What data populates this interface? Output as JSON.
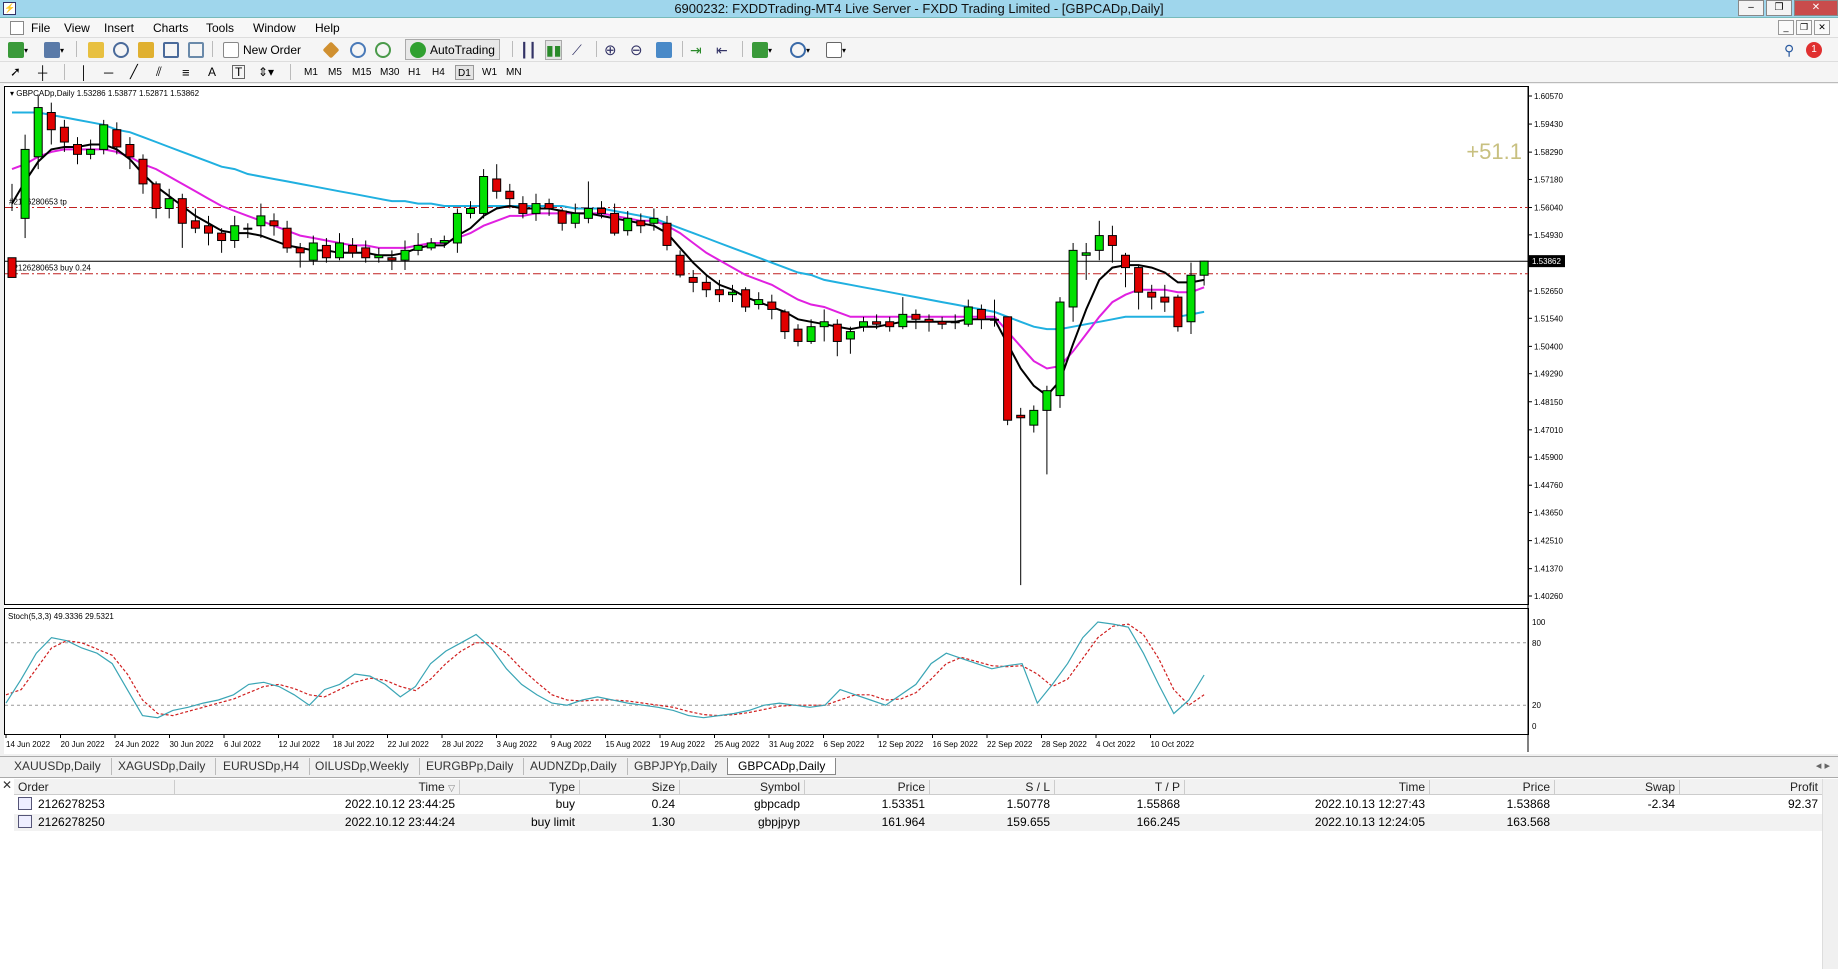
{
  "window": {
    "title": "6900232: FXDDTrading-MT4 Live Server - FXDD Trading Limited - [GBPCADp,Daily]",
    "minimize": "–",
    "restore": "❐",
    "close": "✕"
  },
  "menu": [
    "File",
    "View",
    "Insert",
    "Charts",
    "Tools",
    "Window",
    "Help"
  ],
  "toolbar": {
    "new_order": "New Order",
    "auto_trading": "AutoTrading",
    "timeframes": [
      "M1",
      "M5",
      "M15",
      "M30",
      "H1",
      "H4",
      "D1",
      "W1",
      "MN"
    ],
    "active_timeframe": "D1",
    "notification_count": "1"
  },
  "chart": {
    "header": "GBPCADp,Daily  1.53286 1.53877 1.52871 1.53862",
    "profit_overlay": "+51.1",
    "tp_label": "#2126280653 tp",
    "buy_label": "#2126280653 buy 0.24",
    "price_tag": "1.53862",
    "price_axis": [
      "1.60570",
      "1.59430",
      "1.58290",
      "1.57180",
      "1.56040",
      "1.54930",
      "1.53862",
      "1.52650",
      "1.51540",
      "1.50400",
      "1.49290",
      "1.48150",
      "1.47010",
      "1.45900",
      "1.44760",
      "1.43650",
      "1.42510",
      "1.41370",
      "1.40260"
    ],
    "indicator_header": "Stoch(5,3,3) 49.3336 29.5321",
    "indicator_axis": [
      "100",
      "80",
      "20",
      "0"
    ],
    "date_labels": [
      "14 Jun 2022",
      "20 Jun 2022",
      "24 Jun 2022",
      "30 Jun 2022",
      "6 Jul 2022",
      "12 Jul 2022",
      "18 Jul 2022",
      "22 Jul 2022",
      "28 Jul 2022",
      "3 Aug 2022",
      "9 Aug 2022",
      "15 Aug 2022",
      "19 Aug 2022",
      "25 Aug 2022",
      "31 Aug 2022",
      "6 Sep 2022",
      "12 Sep 2022",
      "16 Sep 2022",
      "22 Sep 2022",
      "28 Sep 2022",
      "4 Oct 2022",
      "10 Oct 2022"
    ],
    "colors": {
      "bull": "#00e000",
      "bear": "#e00000",
      "ma_fast": "#000000",
      "ma_mid": "#e020e0",
      "ma_slow": "#20b0e0",
      "stoch_main": "#3aa5b5",
      "stoch_signal": "#d02020",
      "profit": "#c8c080"
    }
  },
  "chart_data": {
    "type": "candlestick",
    "title": "GBPCADp,Daily",
    "candles": [
      [
        1.54,
        1.532,
        1.559,
        1.57
      ],
      [
        1.556,
        1.584,
        1.59,
        1.548
      ],
      [
        1.581,
        1.601,
        1.606,
        1.576
      ],
      [
        1.599,
        1.592,
        1.603,
        1.586
      ],
      [
        1.593,
        1.587,
        1.596,
        1.583
      ],
      [
        1.586,
        1.582,
        1.589,
        1.578
      ],
      [
        1.582,
        1.584,
        1.588,
        1.58
      ],
      [
        1.584,
        1.594,
        1.596,
        1.582
      ],
      [
        1.592,
        1.585,
        1.595,
        1.582
      ],
      [
        1.586,
        1.581,
        1.589,
        1.576
      ],
      [
        1.58,
        1.57,
        1.582,
        1.566
      ],
      [
        1.57,
        1.56,
        1.571,
        1.556
      ],
      [
        1.56,
        1.564,
        1.568,
        1.556
      ],
      [
        1.564,
        1.554,
        1.566,
        1.544
      ],
      [
        1.555,
        1.552,
        1.56,
        1.55
      ],
      [
        1.553,
        1.55,
        1.557,
        1.545
      ],
      [
        1.55,
        1.547,
        1.552,
        1.542
      ],
      [
        1.547,
        1.553,
        1.557,
        1.544
      ],
      [
        1.552,
        1.552,
        1.554,
        1.548
      ],
      [
        1.553,
        1.557,
        1.562,
        1.548
      ],
      [
        1.555,
        1.553,
        1.558,
        1.549
      ],
      [
        1.552,
        1.544,
        1.555,
        1.542
      ],
      [
        1.544,
        1.542,
        1.546,
        1.536
      ],
      [
        1.539,
        1.546,
        1.549,
        1.537
      ],
      [
        1.545,
        1.54,
        1.548,
        1.538
      ],
      [
        1.54,
        1.546,
        1.55,
        1.539
      ],
      [
        1.545,
        1.542,
        1.548,
        1.54
      ],
      [
        1.544,
        1.54,
        1.547,
        1.538
      ],
      [
        1.54,
        1.541,
        1.544,
        1.538
      ],
      [
        1.54,
        1.539,
        1.543,
        1.535
      ],
      [
        1.539,
        1.543,
        1.547,
        1.535
      ],
      [
        1.543,
        1.545,
        1.55,
        1.541
      ],
      [
        1.544,
        1.546,
        1.548,
        1.543
      ],
      [
        1.546,
        1.547,
        1.549,
        1.544
      ],
      [
        1.546,
        1.558,
        1.56,
        1.542
      ],
      [
        1.558,
        1.56,
        1.563,
        1.556
      ],
      [
        1.558,
        1.573,
        1.576,
        1.556
      ],
      [
        1.572,
        1.567,
        1.578,
        1.564
      ],
      [
        1.567,
        1.564,
        1.57,
        1.56
      ],
      [
        1.562,
        1.558,
        1.565,
        1.556
      ],
      [
        1.558,
        1.562,
        1.566,
        1.555
      ],
      [
        1.562,
        1.56,
        1.564,
        1.557
      ],
      [
        1.559,
        1.554,
        1.56,
        1.551
      ],
      [
        1.554,
        1.558,
        1.562,
        1.552
      ],
      [
        1.556,
        1.56,
        1.571,
        1.554
      ],
      [
        1.56,
        1.558,
        1.563,
        1.556
      ],
      [
        1.558,
        1.55,
        1.562,
        1.549
      ],
      [
        1.551,
        1.556,
        1.559,
        1.549
      ],
      [
        1.555,
        1.553,
        1.558,
        1.55
      ],
      [
        1.554,
        1.556,
        1.56,
        1.551
      ],
      [
        1.554,
        1.545,
        1.557,
        1.543
      ],
      [
        1.541,
        1.533,
        1.543,
        1.532
      ],
      [
        1.532,
        1.53,
        1.535,
        1.526
      ],
      [
        1.53,
        1.527,
        1.533,
        1.524
      ],
      [
        1.527,
        1.525,
        1.531,
        1.522
      ],
      [
        1.525,
        1.526,
        1.529,
        1.522
      ],
      [
        1.527,
        1.52,
        1.528,
        1.518
      ],
      [
        1.521,
        1.523,
        1.526,
        1.519
      ],
      [
        1.522,
        1.519,
        1.525,
        1.515
      ],
      [
        1.518,
        1.51,
        1.519,
        1.507
      ],
      [
        1.511,
        1.506,
        1.513,
        1.504
      ],
      [
        1.506,
        1.512,
        1.515,
        1.505
      ],
      [
        1.512,
        1.514,
        1.519,
        1.506
      ],
      [
        1.513,
        1.506,
        1.515,
        1.5
      ],
      [
        1.507,
        1.51,
        1.512,
        1.501
      ],
      [
        1.512,
        1.514,
        1.516,
        1.51
      ],
      [
        1.514,
        1.513,
        1.517,
        1.511
      ],
      [
        1.514,
        1.512,
        1.516,
        1.51
      ],
      [
        1.512,
        1.517,
        1.524,
        1.511
      ],
      [
        1.517,
        1.515,
        1.519,
        1.511
      ],
      [
        1.515,
        1.514,
        1.517,
        1.51
      ],
      [
        1.514,
        1.513,
        1.516,
        1.511
      ],
      [
        1.514,
        1.514,
        1.517,
        1.511
      ],
      [
        1.513,
        1.52,
        1.523,
        1.512
      ],
      [
        1.519,
        1.515,
        1.521,
        1.511
      ],
      [
        1.515,
        1.515,
        1.523,
        1.512
      ],
      [
        1.516,
        1.474,
        1.516,
        1.472
      ],
      [
        1.476,
        1.475,
        1.479,
        1.407
      ],
      [
        1.472,
        1.478,
        1.48,
        1.469
      ],
      [
        1.478,
        1.486,
        1.488,
        1.452
      ],
      [
        1.484,
        1.522,
        1.524,
        1.479
      ],
      [
        1.52,
        1.543,
        1.546,
        1.514
      ],
      [
        1.541,
        1.542,
        1.546,
        1.531
      ],
      [
        1.543,
        1.549,
        1.555,
        1.539
      ],
      [
        1.549,
        1.545,
        1.553,
        1.538
      ],
      [
        1.541,
        1.536,
        1.542,
        1.528
      ],
      [
        1.536,
        1.526,
        1.537,
        1.519
      ],
      [
        1.526,
        1.524,
        1.529,
        1.519
      ],
      [
        1.524,
        1.522,
        1.529,
        1.518
      ],
      [
        1.524,
        1.512,
        1.525,
        1.51
      ],
      [
        1.514,
        1.5329,
        1.538,
        1.509
      ],
      [
        1.5329,
        1.5386,
        1.5388,
        1.5287
      ]
    ],
    "ma_fast": [
      1.562,
      1.571,
      1.579,
      1.584,
      1.585,
      1.585,
      1.586,
      1.586,
      1.584,
      1.58,
      1.574,
      1.569,
      1.565,
      1.561,
      1.557,
      1.554,
      1.551,
      1.55,
      1.55,
      1.549,
      1.547,
      1.545,
      1.544,
      1.543,
      1.543,
      1.542,
      1.542,
      1.542,
      1.541,
      1.541,
      1.542,
      1.544,
      1.545,
      1.545,
      1.549,
      1.552,
      1.557,
      1.56,
      1.561,
      1.56,
      1.56,
      1.56,
      1.559,
      1.558,
      1.558,
      1.557,
      1.556,
      1.555,
      1.554,
      1.553,
      1.55,
      1.544,
      1.538,
      1.533,
      1.529,
      1.527,
      1.524,
      1.522,
      1.52,
      1.518,
      1.515,
      1.514,
      1.513,
      1.512,
      1.511,
      1.512,
      1.512,
      1.513,
      1.514,
      1.514,
      1.514,
      1.514,
      1.514,
      1.515,
      1.515,
      1.515,
      1.505,
      1.495,
      1.488,
      1.484,
      1.49,
      1.505,
      1.519,
      1.531,
      1.536,
      1.537,
      1.537,
      1.536,
      1.534,
      1.53,
      1.53,
      1.531
    ],
    "ma_mid": [
      1.576,
      1.578,
      1.581,
      1.583,
      1.584,
      1.584,
      1.584,
      1.584,
      1.583,
      1.581,
      1.578,
      1.576,
      1.573,
      1.57,
      1.567,
      1.564,
      1.561,
      1.559,
      1.557,
      1.555,
      1.553,
      1.551,
      1.549,
      1.548,
      1.547,
      1.546,
      1.545,
      1.545,
      1.544,
      1.544,
      1.544,
      1.545,
      1.546,
      1.546,
      1.548,
      1.55,
      1.553,
      1.555,
      1.557,
      1.557,
      1.558,
      1.558,
      1.558,
      1.558,
      1.558,
      1.558,
      1.557,
      1.556,
      1.555,
      1.555,
      1.553,
      1.55,
      1.546,
      1.542,
      1.539,
      1.536,
      1.533,
      1.531,
      1.529,
      1.526,
      1.523,
      1.521,
      1.52,
      1.518,
      1.516,
      1.516,
      1.516,
      1.516,
      1.516,
      1.516,
      1.516,
      1.516,
      1.516,
      1.516,
      1.516,
      1.516,
      1.51,
      1.504,
      1.498,
      1.495,
      1.496,
      1.502,
      1.509,
      1.516,
      1.522,
      1.525,
      1.527,
      1.527,
      1.527,
      1.526,
      1.526,
      1.528
    ],
    "ma_slow": [
      1.599,
      1.599,
      1.599,
      1.598,
      1.597,
      1.596,
      1.595,
      1.594,
      1.592,
      1.591,
      1.589,
      1.587,
      1.585,
      1.583,
      1.581,
      1.579,
      1.577,
      1.576,
      1.574,
      1.573,
      1.572,
      1.571,
      1.57,
      1.569,
      1.568,
      1.567,
      1.566,
      1.565,
      1.564,
      1.563,
      1.563,
      1.562,
      1.562,
      1.561,
      1.561,
      1.561,
      1.561,
      1.561,
      1.561,
      1.561,
      1.561,
      1.561,
      1.561,
      1.56,
      1.56,
      1.56,
      1.559,
      1.558,
      1.557,
      1.556,
      1.554,
      1.552,
      1.55,
      1.548,
      1.546,
      1.544,
      1.542,
      1.54,
      1.538,
      1.536,
      1.534,
      1.533,
      1.531,
      1.53,
      1.529,
      1.528,
      1.527,
      1.526,
      1.525,
      1.524,
      1.523,
      1.522,
      1.521,
      1.52,
      1.519,
      1.518,
      1.516,
      1.514,
      1.512,
      1.511,
      1.511,
      1.512,
      1.513,
      1.514,
      1.515,
      1.516,
      1.516,
      1.516,
      1.516,
      1.516,
      1.517,
      1.518
    ],
    "stoch_main": [
      22,
      45,
      70,
      85,
      82,
      75,
      70,
      60,
      35,
      10,
      8,
      15,
      18,
      22,
      25,
      30,
      40,
      42,
      38,
      30,
      20,
      35,
      40,
      50,
      48,
      40,
      28,
      38,
      60,
      72,
      80,
      88,
      75,
      55,
      40,
      30,
      22,
      20,
      25,
      28,
      25,
      22,
      20,
      18,
      15,
      10,
      8,
      10,
      12,
      15,
      20,
      22,
      20,
      18,
      20,
      35,
      30,
      25,
      20,
      30,
      40,
      60,
      70,
      65,
      60,
      55,
      58,
      60,
      22,
      40,
      60,
      85,
      100,
      98,
      95,
      70,
      40,
      12,
      25,
      49
    ],
    "stoch_signal": [
      30,
      35,
      55,
      75,
      82,
      80,
      74,
      68,
      50,
      25,
      12,
      10,
      14,
      18,
      22,
      26,
      32,
      38,
      40,
      36,
      30,
      28,
      35,
      42,
      46,
      44,
      38,
      34,
      45,
      60,
      72,
      80,
      80,
      70,
      55,
      42,
      30,
      25,
      24,
      25,
      25,
      24,
      22,
      20,
      18,
      14,
      11,
      10,
      11,
      13,
      16,
      19,
      20,
      20,
      20,
      25,
      30,
      30,
      25,
      26,
      32,
      45,
      60,
      66,
      62,
      58,
      57,
      58,
      50,
      38,
      45,
      65,
      85,
      96,
      98,
      88,
      65,
      35,
      20,
      30
    ],
    "positions": {
      "tp": 1.5604,
      "entry": 1.53351,
      "stop": 1.50778
    },
    "ylim": [
      1.4026,
      1.6057
    ],
    "stoch_ylim": [
      0,
      100
    ]
  },
  "tabs": [
    "XAUUSDp,Daily",
    "XAGUSDp,Daily",
    "EURUSDp,H4",
    "OILUSDp,Weekly",
    "EURGBPp,Daily",
    "AUDNZDp,Daily",
    "GBPJPYp,Daily",
    "GBPCADp,Daily"
  ],
  "active_tab": "GBPCADp,Daily",
  "tab_nav": "◂ ▸",
  "terminal": {
    "close": "✕",
    "columns": [
      "Order",
      "Time",
      "Type",
      "Size",
      "Symbol",
      "Price",
      "S / L",
      "T / P",
      "Time",
      "Price",
      "Swap",
      "Profit"
    ],
    "rows": [
      [
        "2126278253",
        "2022.10.12 23:44:25",
        "buy",
        "0.24",
        "gbpcadp",
        "1.53351",
        "1.50778",
        "1.55868",
        "2022.10.13 12:27:43",
        "1.53868",
        "-2.34",
        "92.37"
      ],
      [
        "2126278250",
        "2022.10.12 23:44:24",
        "buy limit",
        "1.30",
        "gbpjpyp",
        "161.964",
        "159.655",
        "166.245",
        "2022.10.13 12:24:05",
        "163.568",
        "",
        ""
      ]
    ]
  }
}
